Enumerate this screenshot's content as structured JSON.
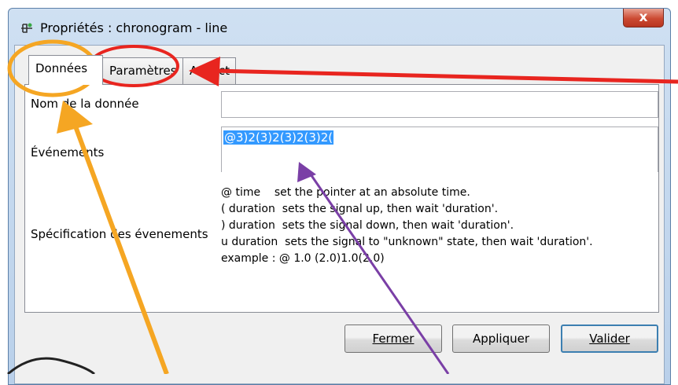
{
  "window": {
    "title": "Propriétés : chronogram - line",
    "close_label": "x"
  },
  "tabs": [
    {
      "label": "Données",
      "active": true
    },
    {
      "label": "Paramètres",
      "active": false
    },
    {
      "label": "Aspect",
      "active": false
    }
  ],
  "form": {
    "name_label": "Nom de la donnée",
    "name_value": "",
    "events_label": "Événements",
    "events_value": "@3)2(3)2(3)2(3)2(",
    "spec_label": "Spécification des évenements",
    "spec_lines": [
      "@ time    set the pointer at an absolute time.",
      "( duration  sets the signal up, then wait 'duration'.",
      ") duration  sets the signal down, then wait 'duration'.",
      "u duration  sets the signal to \"unknown\" state, then wait 'duration'.",
      "example : @ 1.0 (2.0)1.0(2.0)"
    ]
  },
  "buttons": {
    "close": "Fermer",
    "apply": "Appliquer",
    "validate": "Valider"
  },
  "annotation_colors": {
    "orange": "#f5a623",
    "red": "#e8251f",
    "purple": "#7a3fa6"
  }
}
